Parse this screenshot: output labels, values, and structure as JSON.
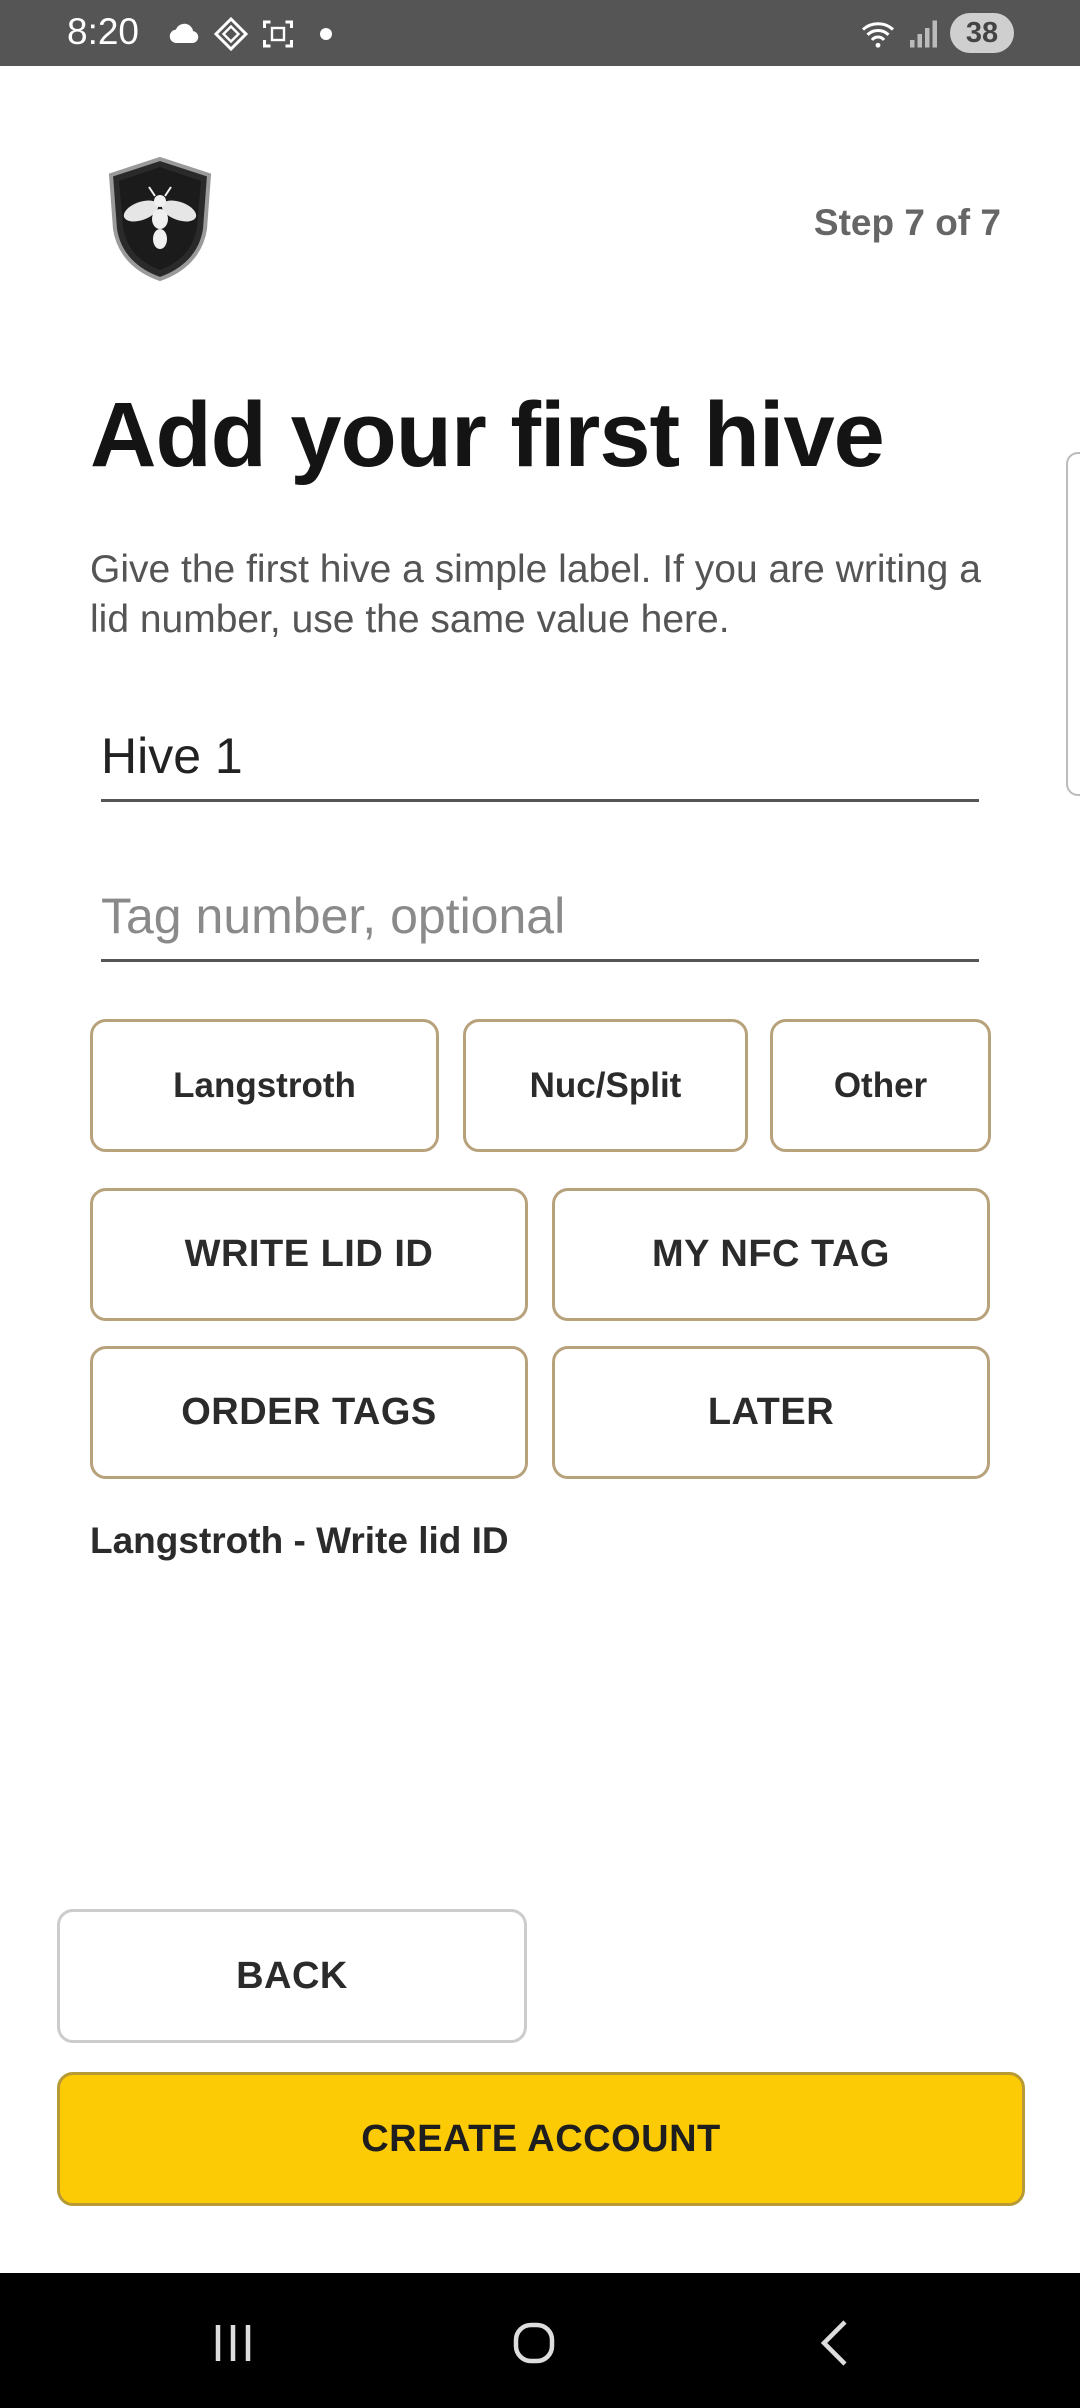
{
  "status_bar": {
    "time": "8:20",
    "battery": "38",
    "icons": [
      "cloud-icon",
      "nfc-chip-icon",
      "screenshot-icon",
      "notification-dot-icon",
      "wifi-icon",
      "signal-icon"
    ]
  },
  "header": {
    "logo_icon": "bee-shield-logo",
    "step_label": "Step 7 of 7"
  },
  "main": {
    "title": "Add your first hive",
    "description": "Give the first hive a simple label. If you are writing a lid number, use the same value here.",
    "hive_name": {
      "value": "Hive 1",
      "placeholder": ""
    },
    "tag_number": {
      "value": "",
      "placeholder": "Tag number, optional"
    },
    "hive_types": [
      "Langstroth",
      "Nuc/Split",
      "Other"
    ],
    "tag_options": {
      "write_lid_id": "WRITE LID ID",
      "my_nfc_tag": "MY NFC TAG",
      "order_tags": "ORDER TAGS",
      "later": "LATER"
    },
    "selection_summary": "Langstroth - Write lid ID"
  },
  "actions": {
    "back_label": "BACK",
    "create_label": "CREATE ACCOUNT"
  },
  "colors": {
    "accent_yellow": "#fccb06",
    "option_border": "#b7a27b",
    "status_bar_bg": "#555555"
  },
  "nav_bar": {
    "icons": [
      "recents-icon",
      "home-icon",
      "back-icon"
    ]
  }
}
